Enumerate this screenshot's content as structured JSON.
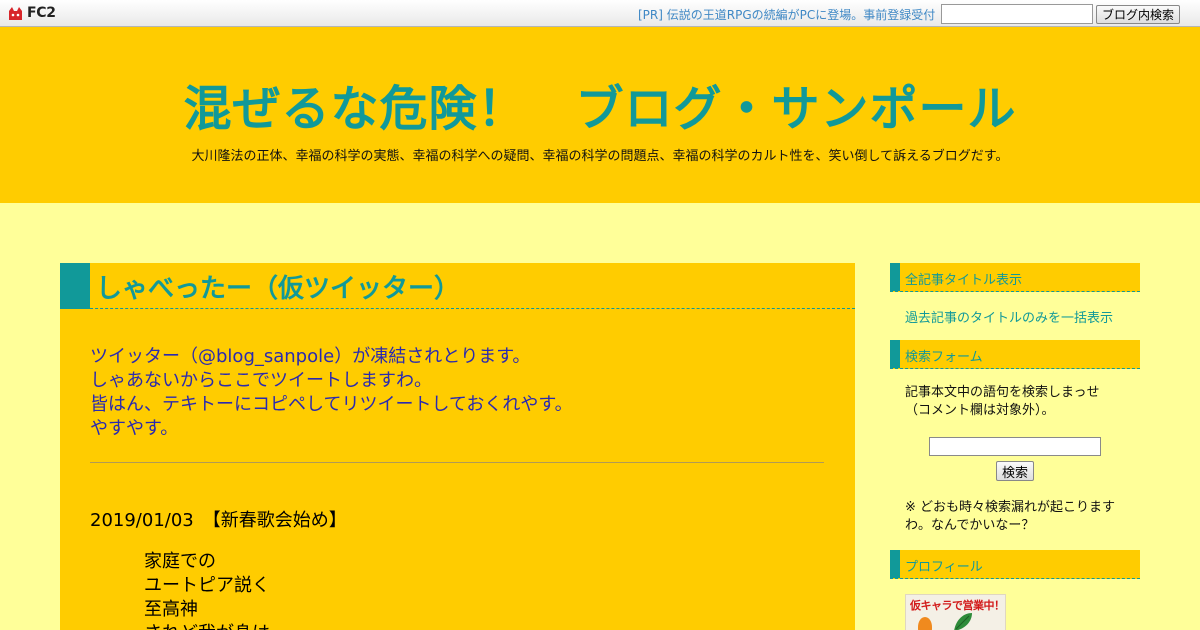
{
  "topbar": {
    "logo_text": "FC2",
    "pr_link": "[PR] 伝説の王道RPGの続編がPCに登場。事前登録受付",
    "search_value": "",
    "search_button": "ブログ内検索"
  },
  "header": {
    "title": "混ぜるな危険！　ブログ・サンポール",
    "description": "大川隆法の正体、幸福の科学の実態、幸福の科学への疑問、幸福の科学の問題点、幸福の科学のカルト性を、笑い倒して訴えるブログだす。"
  },
  "entry": {
    "title": "しゃべったー（仮ツイッター）",
    "intro_prefix": "ツイッター（",
    "intro_link": "@blog_sanpole",
    "intro_suffix": "）が凍結されとります。",
    "line2": "しゃあないからここでツイートしますわ。",
    "line3": "皆はん、テキトーにコピペしてリツイートしておくれやす。",
    "line4": "やすやす。",
    "post_date": "2019/01/03　【新春歌会始め】",
    "poem": [
      "家庭での",
      "ユートピア説く",
      "至高神",
      "されど我が身は"
    ]
  },
  "sidebar": {
    "all_titles": {
      "heading": "全記事タイトル表示",
      "link": "過去記事のタイトルのみを一括表示"
    },
    "search": {
      "heading": "検索フォーム",
      "desc_line1": "記事本文中の語句を検索しまっせ",
      "desc_line2": "（コメント欄は対象外）。",
      "input_value": "",
      "button": "検索",
      "note_line1": "※ どおも時々検索漏れが起こります",
      "note_line2": "わ。なんでかいなー？"
    },
    "profile": {
      "heading": "プロフィール",
      "image_caption": "仮キャラで営業中！"
    }
  },
  "colors": {
    "accent": "#119999",
    "header_bg": "#ffcc00",
    "page_bg": "#ffff99",
    "link": "#2a2ab0"
  }
}
